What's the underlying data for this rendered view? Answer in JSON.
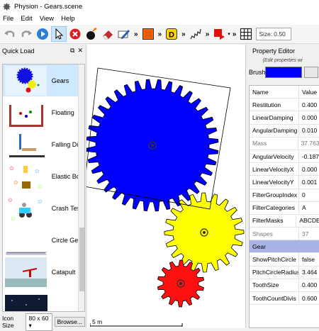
{
  "window": {
    "title": "Physion - Gears.scene"
  },
  "menu": [
    "File",
    "Edit",
    "View",
    "Help"
  ],
  "toolbar": {
    "size_label": "Size:",
    "size_value": "0.50"
  },
  "quick_load": {
    "title": "Quick Load",
    "items": [
      {
        "label": "Gears"
      },
      {
        "label": "Floating"
      },
      {
        "label": "Falling Di"
      },
      {
        "label": "Elastic Bo"
      },
      {
        "label": "Crash Tes"
      },
      {
        "label": "Circle Ge"
      },
      {
        "label": "Catapult"
      }
    ],
    "icon_size_label": "Icon Size",
    "icon_size_value": "80 x 60 ▾",
    "browse_label": "Browse..."
  },
  "canvas": {
    "scale_label": "5 m"
  },
  "property_editor": {
    "title": "Property Editor",
    "hint": "(Edit properties wi",
    "brush_label": "Brush",
    "brush_color": "#0000ff",
    "columns": {
      "name": "Name",
      "value": "Value"
    },
    "rows": [
      {
        "name": "Restitution",
        "value": "0.400"
      },
      {
        "name": "LinearDamping",
        "value": "0.000"
      },
      {
        "name": "AngularDamping",
        "value": "0.010"
      },
      {
        "name": "Mass",
        "value": "37.763"
      },
      {
        "name": "AngularVelocity",
        "value": "-0.187"
      },
      {
        "name": "LinearVelocityX",
        "value": "0.000"
      },
      {
        "name": "LinearVelocityY",
        "value": "0.001"
      },
      {
        "name": "FilterGroupIndex",
        "value": "0"
      },
      {
        "name": "FilterCategories",
        "value": "A"
      },
      {
        "name": "FilterMasks",
        "value": "ABCDE"
      },
      {
        "name": "Shapes",
        "value": "37"
      },
      {
        "name": "Gear",
        "value": ""
      },
      {
        "name": "ShowPitchCircle",
        "value": "false"
      },
      {
        "name": "PitchCircleRadius",
        "value": "3.464"
      },
      {
        "name": "ToothSize",
        "value": "0.400"
      },
      {
        "name": "ToothCountDivis",
        "value": "0.600"
      }
    ]
  }
}
